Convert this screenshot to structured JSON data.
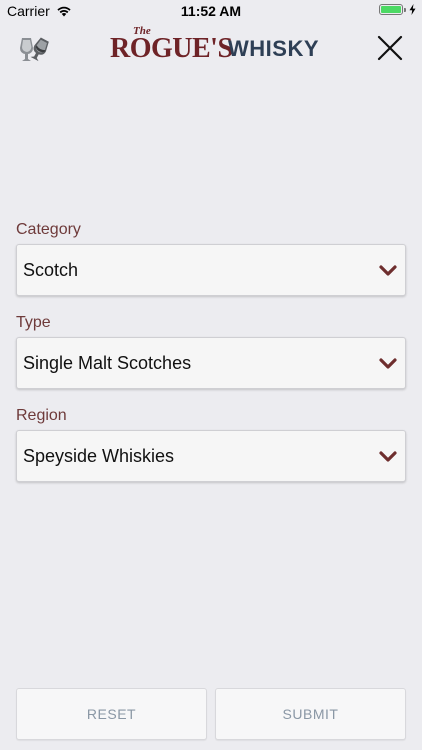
{
  "status_bar": {
    "carrier": "Carrier",
    "time": "11:52 AM",
    "battery_level": 1.0,
    "icons": [
      "wifi-icon",
      "battery-icon",
      "charging-bolt-icon"
    ]
  },
  "nav_bar": {
    "logo_the": "The",
    "logo_rogues": "ROGUE'S",
    "logo_whisky": "WHISKY",
    "left_icon": "glasses-icon",
    "right_icon": "close-icon"
  },
  "form": {
    "category": {
      "label": "Category",
      "value": "Scotch"
    },
    "type": {
      "label": "Type",
      "value": "Single Malt Scotches"
    },
    "region": {
      "label": "Region",
      "value": "Speyside Whiskies"
    }
  },
  "buttons": {
    "reset": "RESET",
    "submit": "SUBMIT"
  },
  "colors": {
    "background": "#ececf0",
    "label": "#6e3a3a",
    "chevron": "#6e2e2e",
    "logo_red": "#6e2327",
    "logo_navy": "#2e3f55",
    "button_text": "#8a97a5"
  }
}
